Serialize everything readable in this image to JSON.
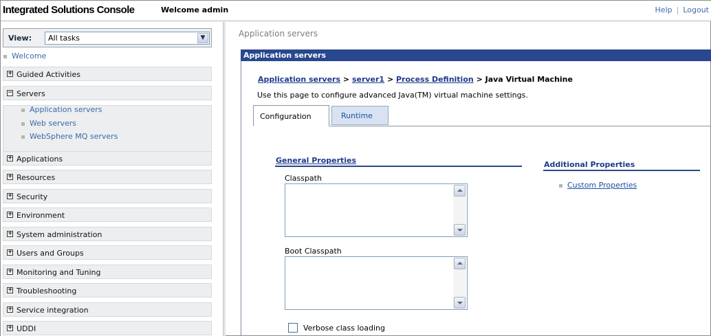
{
  "banner": {
    "app_title": "Integrated Solutions Console",
    "welcome": "Welcome admin",
    "help": "Help",
    "separator": "|",
    "logout": "Logout"
  },
  "nav": {
    "view_label": "View:",
    "view_value": "All tasks",
    "welcome": "Welcome",
    "groups": [
      {
        "label": "Guided Activities",
        "state": "+"
      },
      {
        "label": "Servers",
        "state": "−"
      },
      {
        "label": "Applications",
        "state": "+"
      },
      {
        "label": "Resources",
        "state": "+"
      },
      {
        "label": "Security",
        "state": "+"
      },
      {
        "label": "Environment",
        "state": "+"
      },
      {
        "label": "System administration",
        "state": "+"
      },
      {
        "label": "Users and Groups",
        "state": "+"
      },
      {
        "label": "Monitoring and Tuning",
        "state": "+"
      },
      {
        "label": "Troubleshooting",
        "state": "+"
      },
      {
        "label": "Service integration",
        "state": "+"
      },
      {
        "label": "UDDI",
        "state": "+"
      }
    ],
    "servers_items": [
      "Application servers",
      "Web servers",
      "WebSphere MQ servers"
    ]
  },
  "content": {
    "page_heading": "Application servers",
    "panel_title": "Application servers",
    "breadcrumb": {
      "link1": "Application servers",
      "sep": ">",
      "link2": "server1",
      "link3": "Process Definition",
      "current": "Java Virtual Machine"
    },
    "description": "Use this page to configure advanced Java(TM) virtual machine settings.",
    "tabs": [
      "Configuration",
      "Runtime"
    ],
    "general_properties": "General Properties",
    "classpath_label": "Classpath",
    "boot_classpath_label": "Boot Classpath",
    "verbose_label": "Verbose class loading",
    "verbose_checked": false,
    "additional_properties": "Additional Properties",
    "custom_properties": "Custom Properties"
  }
}
